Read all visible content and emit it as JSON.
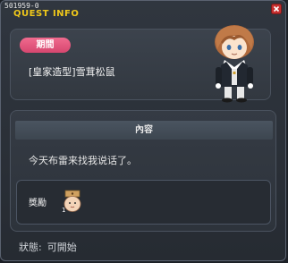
{
  "window": {
    "quest_id": "501959-0",
    "title": "QUEST INFO"
  },
  "period": {
    "badge_label": "期間",
    "quest_name": "[皇家造型]雪茸松鼠"
  },
  "content": {
    "header_label": "內容",
    "description": "今天布雷来找我说话了。"
  },
  "reward": {
    "label": "獎勵",
    "item_count": "1"
  },
  "status": {
    "label": "狀態:",
    "value": "可開始"
  },
  "colors": {
    "title": "#f0c81a",
    "badge": "#e05a80",
    "close": "#c83030"
  },
  "icons": [
    "close-icon",
    "character-portrait",
    "reward-item-icon"
  ]
}
